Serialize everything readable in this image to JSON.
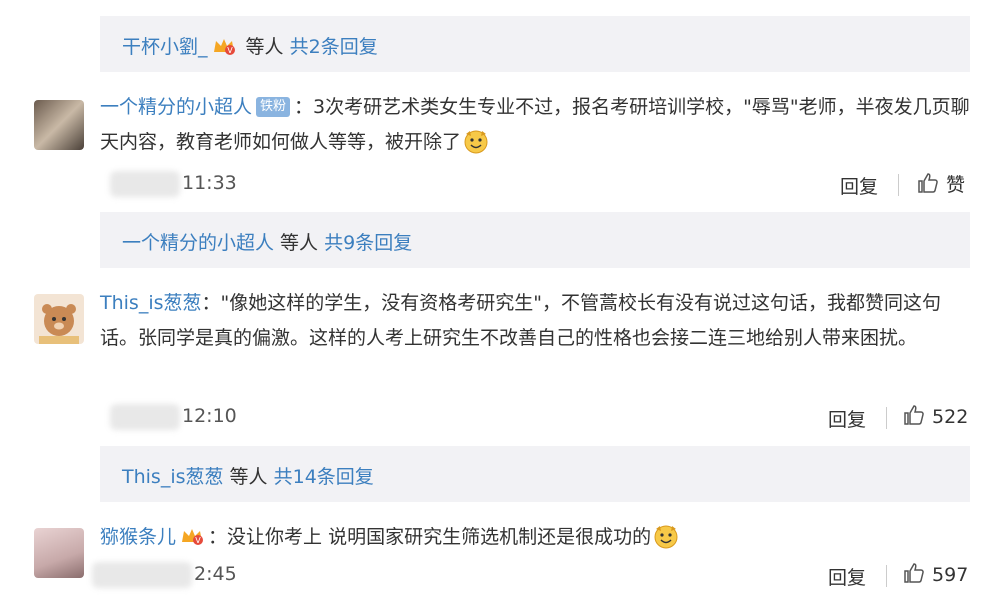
{
  "reply_bars": [
    {
      "name": "干杯小劉_",
      "middle": " 等人 ",
      "count": "共2条回复"
    },
    {
      "name": "一个精分的小超人",
      "middle": " 等人 ",
      "count": "共9条回复"
    },
    {
      "name": "This_is葱葱",
      "middle": " 等人 ",
      "count": "共14条回复"
    }
  ],
  "comments": [
    {
      "username": "一个精分的小超人",
      "badge": "铁粉",
      "colon": "：",
      "text": "3次考研艺术类女生专业不过，报名考研培训学校，\"辱骂\"老师，半夜发几页聊天内容，教育老师如何做人等等，被开除了",
      "time": "11:33",
      "reply": "回复",
      "like": "赞"
    },
    {
      "username": "This_is葱葱",
      "colon": "：",
      "text": "\"像她这样的学生，没有资格考研究生\"，不管蒿校长有没有说过这句话，我都赞同这句话。张同学是真的偏激。这样的人考上研究生不改善自己的性格也会接二连三地给别人带来困扰。",
      "time": "12:10",
      "reply": "回复",
      "like": "522"
    },
    {
      "username": "猕猴条儿",
      "colon": "：",
      "text": "没让你考上 说明国家研究生筛选机制还是很成功的",
      "time": "2:45",
      "reply": "回复",
      "like": "597"
    }
  ],
  "icons": [
    "crown-icon",
    "fan-badge",
    "smile-emoji-icon",
    "thumbs-up-icon"
  ],
  "colors": {
    "link": "#3c7fbf",
    "bar": "#f2f2f5",
    "badge": "#8ab4e0"
  }
}
